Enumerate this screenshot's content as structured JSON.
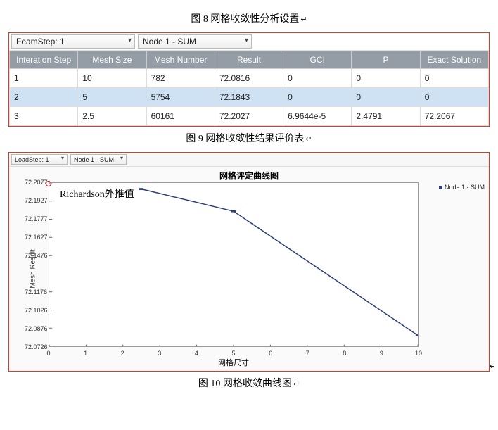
{
  "captions": {
    "fig8": "图 8 网格收敛性分析设置",
    "fig9": "图 9 网格收敛性结果评价表",
    "fig10": "图 10 网格收敛曲线图",
    "ret": "↵"
  },
  "table_toolbar": {
    "step_label": "FeamStep: 1",
    "node_label": "Node 1 - SUM"
  },
  "table": {
    "headers": [
      "Interation Step",
      "Mesh Size",
      "Mesh Number",
      "Result",
      "GCI",
      "P",
      "Exact Solution"
    ],
    "rows": [
      [
        "1",
        "10",
        "782",
        "72.0816",
        "0",
        "0",
        "0"
      ],
      [
        "2",
        "5",
        "5754",
        "72.1843",
        "0",
        "0",
        "0"
      ],
      [
        "3",
        "2.5",
        "60161",
        "72.2027",
        "6.9644e-5",
        "2.4791",
        "72.2067"
      ]
    ],
    "selected_row": 1
  },
  "chart_toolbar": {
    "step_label": "LoadStep: 1",
    "node_label": "Node 1 - SUM"
  },
  "chart_data": {
    "type": "line",
    "title": "网格评定曲线图",
    "xlabel": "网格尺寸",
    "ylabel": "Mesh Result",
    "xlim": [
      0,
      10
    ],
    "xticks": [
      0,
      1,
      2,
      3,
      4,
      5,
      6,
      7,
      8,
      9,
      10
    ],
    "ylim": [
      72.0726,
      72.2077
    ],
    "yticks": [
      72.0726,
      72.0876,
      72.1026,
      72.1176,
      72.1476,
      72.1627,
      72.1777,
      72.1927,
      72.2077
    ],
    "series": [
      {
        "name": "Node 1 - SUM",
        "x": [
          2.5,
          5,
          10
        ],
        "y": [
          72.2027,
          72.1843,
          72.0816
        ]
      }
    ],
    "extrapolated_point": {
      "x": 0,
      "y": 72.2067
    },
    "annotation": "Richardson外推值"
  }
}
